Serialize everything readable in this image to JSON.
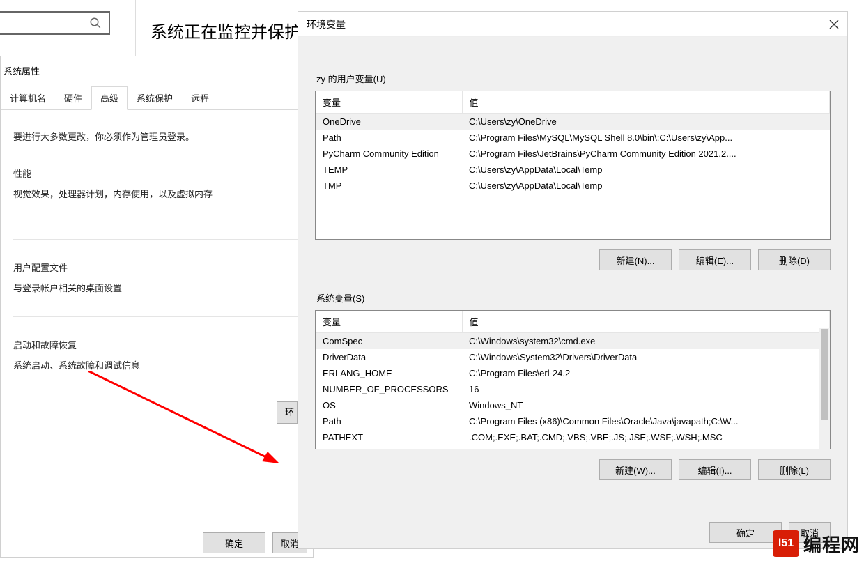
{
  "search": {
    "placeholder": ""
  },
  "background": {
    "title": "系统正在监控并保护"
  },
  "sysprops": {
    "title": "系统属性",
    "tabs": [
      "计算机名",
      "硬件",
      "高级",
      "系统保护",
      "远程"
    ],
    "active_tab": 2,
    "admin_note": "要进行大多数更改，你必须作为管理员登录。",
    "perf": {
      "title": "性能",
      "desc": "视觉效果，处理器计划，内存使用，以及虚拟内存"
    },
    "profile": {
      "title": "用户配置文件",
      "desc": "与登录帐户相关的桌面设置"
    },
    "startup": {
      "title": "启动和故障恢复",
      "desc": "系统启动、系统故障和调试信息"
    },
    "env_btn_cut": "环",
    "ok": "确定",
    "cancel": "取消"
  },
  "env": {
    "title": "环境变量",
    "user_section": "zy 的用户变量(U)",
    "sys_section": "系统变量(S)",
    "header_var": "变量",
    "header_val": "值",
    "user_vars": [
      {
        "name": "OneDrive",
        "value": "C:\\Users\\zy\\OneDrive",
        "sel": true
      },
      {
        "name": "Path",
        "value": "C:\\Program Files\\MySQL\\MySQL Shell 8.0\\bin\\;C:\\Users\\zy\\App..."
      },
      {
        "name": "PyCharm Community Edition",
        "value": "C:\\Program Files\\JetBrains\\PyCharm Community Edition 2021.2...."
      },
      {
        "name": "TEMP",
        "value": "C:\\Users\\zy\\AppData\\Local\\Temp"
      },
      {
        "name": "TMP",
        "value": "C:\\Users\\zy\\AppData\\Local\\Temp"
      }
    ],
    "sys_vars": [
      {
        "name": "ComSpec",
        "value": "C:\\Windows\\system32\\cmd.exe",
        "sel": true
      },
      {
        "name": "DriverData",
        "value": "C:\\Windows\\System32\\Drivers\\DriverData"
      },
      {
        "name": "ERLANG_HOME",
        "value": "C:\\Program Files\\erl-24.2"
      },
      {
        "name": "NUMBER_OF_PROCESSORS",
        "value": "16"
      },
      {
        "name": "OS",
        "value": "Windows_NT"
      },
      {
        "name": "Path",
        "value": "C:\\Program Files (x86)\\Common Files\\Oracle\\Java\\javapath;C:\\W..."
      },
      {
        "name": "PATHEXT",
        "value": ".COM;.EXE;.BAT;.CMD;.VBS;.VBE;.JS;.JSE;.WSF;.WSH;.MSC"
      }
    ],
    "user_btns": {
      "new": "新建(N)...",
      "edit": "编辑(E)...",
      "del": "删除(D)"
    },
    "sys_btns": {
      "new": "新建(W)...",
      "edit": "编辑(I)...",
      "del": "删除(L)"
    },
    "ok": "确定",
    "cancel": "取消"
  },
  "watermark": {
    "logo": "l51",
    "text": "编程网"
  }
}
